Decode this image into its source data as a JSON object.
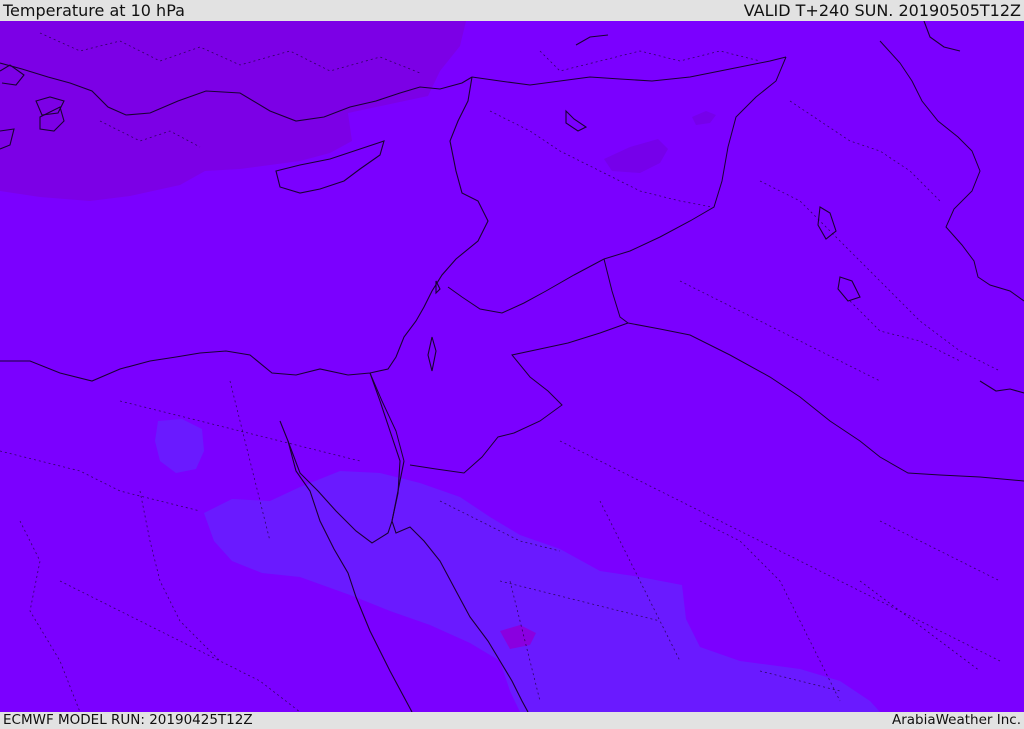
{
  "header": {
    "title": "Temperature at 10 hPa",
    "valid": "VALID T+240 SUN. 20190505T12Z"
  },
  "footer": {
    "model_run": "ECMWF MODEL RUN: 20190425T12Z",
    "credit": "ArabiaWeather Inc."
  },
  "colors": {
    "field_main": "#7b00ff",
    "field_cold": "#7c00e6",
    "field_warm": "#6a1aff",
    "coastline": "#1a0033",
    "bar_background": "#e2e2e2"
  }
}
